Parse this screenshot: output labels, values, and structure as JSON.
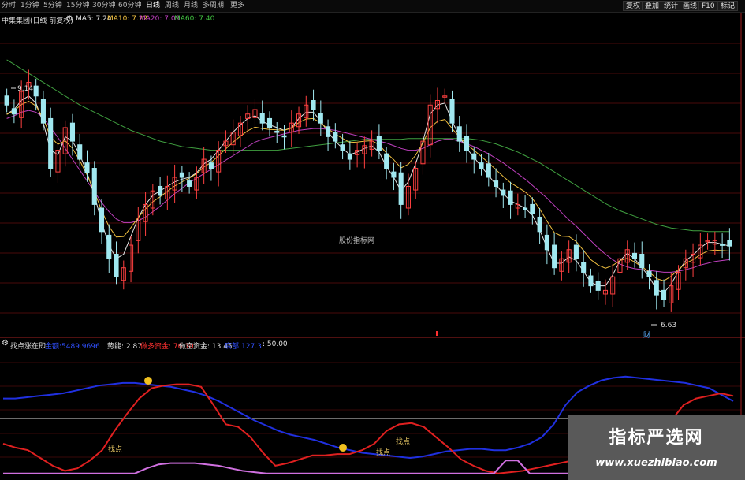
{
  "toolbar": {
    "timeframes": [
      "分时",
      "1分钟",
      "5分钟",
      "15分钟",
      "30分钟",
      "60分钟",
      "日线",
      "周线",
      "月线",
      "多周期",
      "更多"
    ],
    "active_timeframe": "日线",
    "right_buttons": [
      "复权",
      "叠加",
      "统计",
      "画线",
      "F10",
      "标记"
    ]
  },
  "main_panel": {
    "title": "中集集团(日线 前复权)",
    "ma_items": [
      {
        "label": "MA5: 7.24",
        "color": "#e6e6e6"
      },
      {
        "label": "MA10: 7.22",
        "color": "#f0c040"
      },
      {
        "label": "MA20: 7.09",
        "color": "#c040c0"
      },
      {
        "label": "MA60: 7.40",
        "color": "#40c040"
      }
    ],
    "high_label": "9.14",
    "low_label": "6.63",
    "center_text": "股份指标网",
    "event_marker": "财"
  },
  "indicator_panel": {
    "title": "找点涨在即",
    "items": [
      {
        "label": "金额:5489.9696",
        "color": "#3050ff"
      },
      {
        "label": "势能: 2.87",
        "color": "#e0e0e0"
      },
      {
        "label": "做多资金: 76.10",
        "color": "#ff3030"
      },
      {
        "label": "做空资金: 13.45",
        "color": "#e0e0e0"
      },
      {
        "label": "底部:127.3",
        "color": "#3050ff"
      },
      {
        "label": ": 50.00",
        "color": "#e0e0e0"
      }
    ],
    "signal_labels": [
      "找点",
      "找点",
      "找点"
    ]
  },
  "watermark": {
    "title": "指标严选网",
    "url": "www.xuezhibiao.com"
  },
  "colors": {
    "up_candle": "#a0e8f0",
    "down_candle": "#ff4040",
    "ma5": "#e6e6e6",
    "ma10": "#f0c040",
    "ma20": "#c040c0",
    "ma60": "#40a040",
    "blue_line": "#2030e0",
    "red_line": "#e02020",
    "pink_line": "#d070e0"
  },
  "chart_data": {
    "type": "candlestick",
    "price_range": [
      6.3,
      9.7
    ],
    "indicator_range": [
      0,
      100
    ],
    "closes": [
      8.8,
      8.7,
      8.95,
      9.05,
      8.9,
      8.6,
      8.1,
      8.3,
      8.55,
      8.4,
      8.2,
      8.05,
      7.7,
      7.4,
      7.1,
      6.9,
      7.0,
      7.25,
      7.55,
      7.7,
      7.85,
      7.8,
      7.9,
      8.0,
      8.0,
      7.9,
      8.0,
      8.2,
      8.1,
      8.3,
      8.4,
      8.5,
      8.6,
      8.7,
      8.75,
      8.6,
      8.55,
      8.5,
      8.45,
      8.6,
      8.7,
      8.8,
      8.75,
      8.6,
      8.45,
      8.4,
      8.3,
      8.2,
      8.3,
      8.35,
      8.4,
      8.3,
      8.1,
      8.0,
      7.7,
      7.9,
      8.1,
      8.4,
      8.8,
      8.85,
      8.9,
      8.6,
      8.4,
      8.3,
      8.2,
      8.1,
      8.0,
      7.9,
      7.8,
      7.7,
      7.7,
      7.65,
      7.6,
      7.4,
      7.2,
      7.0,
      7.1,
      7.2,
      7.1,
      6.95,
      6.8,
      6.75,
      6.75,
      6.9,
      7.1,
      7.2,
      7.1,
      7.0,
      6.9,
      6.7,
      6.65,
      6.8,
      6.95,
      7.1,
      7.15,
      7.25,
      7.3,
      7.3,
      7.25,
      7.24
    ],
    "ma5_values": [
      8.7,
      8.75,
      8.85,
      8.9,
      8.82,
      8.6,
      8.3,
      8.25,
      8.45,
      8.4,
      8.25,
      8.05,
      7.8,
      7.5,
      7.25,
      7.1,
      7.15,
      7.35,
      7.55,
      7.7,
      7.8,
      7.85,
      7.9,
      7.95,
      7.98,
      8.0,
      8.05,
      8.15,
      8.2,
      8.3,
      8.4,
      8.5,
      8.58,
      8.65,
      8.68,
      8.62,
      8.58,
      8.55,
      8.52,
      8.55,
      8.65,
      8.72,
      8.72,
      8.62,
      8.5,
      8.4,
      8.32,
      8.25,
      8.28,
      8.32,
      8.35,
      8.28,
      8.12,
      8.0,
      7.85,
      7.95,
      8.15,
      8.4,
      8.7,
      8.8,
      8.82,
      8.62,
      8.45,
      8.32,
      8.22,
      8.12,
      8.02,
      7.92,
      7.82,
      7.74,
      7.7,
      7.66,
      7.58,
      7.42,
      7.22,
      7.05,
      7.05,
      7.12,
      7.08,
      6.96,
      6.84,
      6.8,
      6.8,
      6.92,
      7.08,
      7.16,
      7.1,
      7.0,
      6.9,
      6.76,
      6.72,
      6.82,
      6.96,
      7.08,
      7.14,
      7.22,
      7.28,
      7.28,
      7.26,
      7.24
    ],
    "ma20_values": [
      8.65,
      8.68,
      8.72,
      8.74,
      8.72,
      8.66,
      8.55,
      8.44,
      8.32,
      8.2,
      8.08,
      7.96,
      7.84,
      7.72,
      7.62,
      7.54,
      7.5,
      7.5,
      7.52,
      7.56,
      7.62,
      7.68,
      7.75,
      7.82,
      7.88,
      7.94,
      7.99,
      8.04,
      8.09,
      8.14,
      8.19,
      8.24,
      8.29,
      8.34,
      8.39,
      8.42,
      8.44,
      8.46,
      8.48,
      8.5,
      8.52,
      8.53,
      8.54,
      8.54,
      8.53,
      8.52,
      8.5,
      8.48,
      8.46,
      8.44,
      8.42,
      8.4,
      8.38,
      8.35,
      8.32,
      8.3,
      8.3,
      8.32,
      8.36,
      8.4,
      8.42,
      8.42,
      8.4,
      8.37,
      8.34,
      8.3,
      8.26,
      8.21,
      8.16,
      8.1,
      8.04,
      7.98,
      7.91,
      7.84,
      7.77,
      7.69,
      7.61,
      7.53,
      7.46,
      7.38,
      7.3,
      7.22,
      7.15,
      7.09,
      7.04,
      7.01,
      6.99,
      6.98,
      6.97,
      6.96,
      6.95,
      6.95,
      6.96,
      6.98,
      7.0,
      7.03,
      7.05,
      7.07,
      7.08,
      7.09
    ],
    "ma60_values": [
      9.3,
      9.25,
      9.2,
      9.15,
      9.1,
      9.05,
      9.0,
      8.95,
      8.9,
      8.85,
      8.8,
      8.76,
      8.72,
      8.68,
      8.64,
      8.6,
      8.56,
      8.52,
      8.49,
      8.46,
      8.43,
      8.4,
      8.38,
      8.36,
      8.34,
      8.33,
      8.32,
      8.31,
      8.3,
      8.3,
      8.3,
      8.3,
      8.3,
      8.3,
      8.3,
      8.3,
      8.3,
      8.3,
      8.31,
      8.32,
      8.33,
      8.34,
      8.35,
      8.36,
      8.37,
      8.38,
      8.39,
      8.4,
      8.41,
      8.42,
      8.42,
      8.42,
      8.42,
      8.42,
      8.42,
      8.43,
      8.43,
      8.43,
      8.43,
      8.43,
      8.43,
      8.43,
      8.43,
      8.43,
      8.42,
      8.41,
      8.39,
      8.37,
      8.34,
      8.31,
      8.28,
      8.24,
      8.2,
      8.16,
      8.11,
      8.06,
      8.01,
      7.96,
      7.91,
      7.86,
      7.81,
      7.76,
      7.71,
      7.67,
      7.63,
      7.6,
      7.57,
      7.54,
      7.51,
      7.48,
      7.46,
      7.44,
      7.43,
      7.42,
      7.41,
      7.41,
      7.4,
      7.4,
      7.4,
      7.4
    ],
    "indicator_series": [
      {
        "values": [
          60,
          60,
          61,
          62,
          63,
          64,
          66,
          68,
          70,
          71,
          72,
          72,
          71,
          70,
          69,
          67,
          65,
          62,
          58,
          53,
          48,
          43,
          39,
          35,
          32,
          30,
          28,
          25,
          22,
          20,
          18,
          17,
          16,
          15,
          14,
          15,
          17,
          19,
          20,
          21,
          21,
          20,
          20,
          22,
          25,
          30,
          40,
          55,
          65,
          70,
          74,
          76,
          77,
          76,
          75,
          74,
          73,
          72,
          70,
          68,
          63,
          58
        ]
      },
      {
        "values": [
          25,
          22,
          20,
          14,
          8,
          4,
          6,
          12,
          20,
          35,
          48,
          60,
          68,
          70,
          71,
          71,
          69,
          55,
          40,
          38,
          30,
          18,
          8,
          10,
          13,
          16,
          16,
          17,
          17,
          20,
          25,
          35,
          40,
          41,
          38,
          30,
          22,
          13,
          8,
          4,
          2,
          3,
          4,
          6,
          8,
          10,
          12,
          14,
          16,
          20,
          22,
          25,
          30,
          36,
          43,
          55,
          60,
          62,
          64,
          62
        ]
      },
      {
        "values": [
          2,
          2,
          2,
          2,
          2,
          2,
          2,
          2,
          2,
          2,
          2,
          2,
          6,
          9,
          10,
          10,
          10,
          9,
          8,
          6,
          4,
          3,
          2,
          2,
          2,
          2,
          2,
          2,
          2,
          2,
          2,
          2,
          2,
          2,
          2,
          2,
          2,
          2,
          2,
          2,
          2,
          2,
          12,
          12,
          2,
          2,
          2,
          2,
          2,
          2,
          2,
          2,
          2,
          2,
          2,
          2,
          2,
          2,
          2,
          2,
          2,
          2
        ]
      }
    ]
  }
}
